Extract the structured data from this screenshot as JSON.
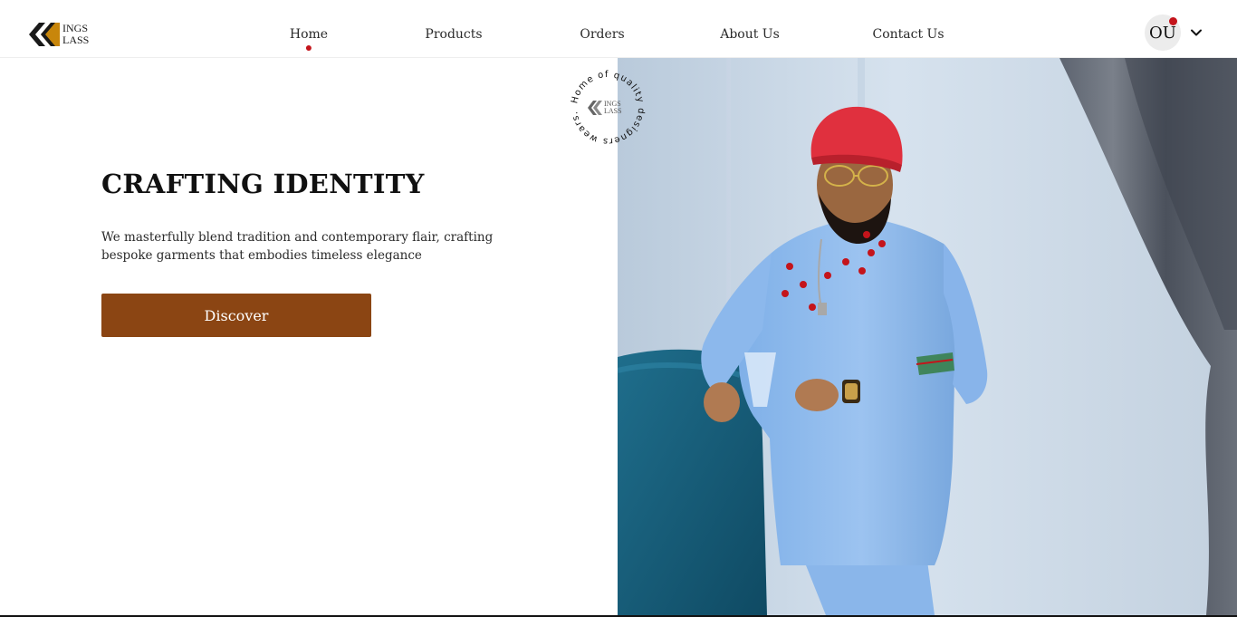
{
  "brand": {
    "line1": "INGS",
    "line2": "LASS"
  },
  "nav": {
    "items": [
      {
        "label": "Home",
        "active": true
      },
      {
        "label": "Products",
        "active": false
      },
      {
        "label": "Orders",
        "active": false
      },
      {
        "label": "About Us",
        "active": false
      },
      {
        "label": "Contact Us",
        "active": false
      }
    ]
  },
  "user": {
    "initials": "OU",
    "has_notification": true
  },
  "hero": {
    "title": "CRAFTING IDENTITY",
    "description": "We masterfully blend tradition and contemporary flair, crafting bespoke garments that embodies timeless elegance",
    "cta_label": "Discover"
  },
  "badge": {
    "circle_text": "Home of quality designers wears.",
    "brand_line1": "INGS",
    "brand_line2": "LASS"
  },
  "colors": {
    "accent_brown": "#8b4513",
    "notification_red": "#c4141b",
    "logo_gold": "#c8860b",
    "logo_dark": "#1a1a1a"
  }
}
